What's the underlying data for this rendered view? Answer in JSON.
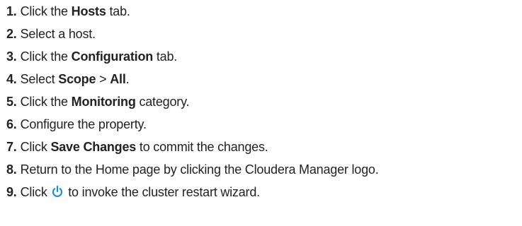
{
  "steps": [
    {
      "num": "1.",
      "pre": "Click the ",
      "bold": "Hosts",
      "post": " tab."
    },
    {
      "num": "2.",
      "text": "Select a host."
    },
    {
      "num": "3.",
      "pre": "Click the ",
      "bold": "Configuration",
      "post": " tab."
    },
    {
      "num": "4.",
      "pre": "Select ",
      "bold": "Scope",
      "mid": " > ",
      "bold2": "All",
      "post": "."
    },
    {
      "num": "5.",
      "pre": "Click the ",
      "bold": "Monitoring",
      "post": " category."
    },
    {
      "num": "6.",
      "text": "Configure the property."
    },
    {
      "num": "7.",
      "pre": "Click ",
      "bold": "Save Changes",
      "post": " to commit the changes."
    },
    {
      "num": "8.",
      "text": "Return to the Home page by clicking the Cloudera Manager logo."
    },
    {
      "num": "9.",
      "pre": "Click ",
      "icon": "restart-power-icon",
      "post": " to invoke the cluster restart wizard."
    }
  ],
  "colors": {
    "icon": "#1a8fd6",
    "text": "#222222"
  }
}
